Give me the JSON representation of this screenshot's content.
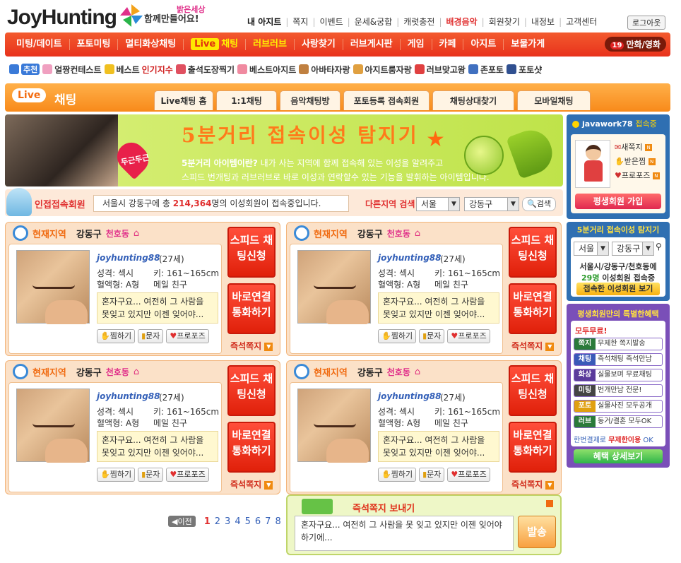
{
  "header": {
    "logo": "JoyHunting",
    "slogan": "함께만들어요!",
    "bright_world": "밝은세상",
    "top_links": [
      "내 아지트",
      "쪽지",
      "이벤트",
      "운세&궁합",
      "캐럿충전",
      "배경음악",
      "회원찾기",
      "내정보",
      "고객센터"
    ],
    "logout": "로그아웃"
  },
  "main_nav": {
    "items": [
      "미팅/데이트",
      "포토미팅",
      "멀티화상채팅",
      "채팅",
      "러브러브",
      "사랑찾기",
      "러브게시판",
      "게임",
      "카페",
      "아지트",
      "보물가게"
    ],
    "live_badge": "Live",
    "adult": "만화/영화",
    "adult_badge": "19"
  },
  "sub_nav": {
    "recommend": "추천",
    "items": [
      "얼짱컨테스트",
      "베스트",
      "인기지수",
      "출석도장찍기",
      "베스트아지트",
      "아바타자랑",
      "아지트룸자랑",
      "러브맞고왕",
      "존포토",
      "포토샷"
    ]
  },
  "live_chat": {
    "badge": "Live",
    "title": "채팅",
    "tabs": [
      "Live채팅 홈",
      "1:1채팅",
      "음악채팅방",
      "포토등록 접속회원",
      "채팅상대찾기",
      "모바일채팅"
    ]
  },
  "banner": {
    "title": "5분거리 접속이성 탐지기",
    "heart": "두근두근",
    "q": "5분거리 아이템이란?",
    "line1": "내가 사는 지역에 함께 접속해 있는 이성을 알려주고",
    "line2": "스피드 번개팅과 러브러브로 바로 이성과 연락할수 있는 기능을 발휘하는 아이템입니다."
  },
  "nearby": {
    "label": "인접접속회원",
    "prefix": "서울시 강동구에 총 ",
    "count": "214,364",
    "suffix": "명의 이성회원이 접속중입니다.",
    "other_label": "다른지역 검색",
    "city": "서울",
    "district": "강동구",
    "search": "검색"
  },
  "card": {
    "current_label": "현재지역",
    "district": "강동구",
    "dong": "천호동",
    "username": "joyhunting88",
    "age": "(27세)",
    "personality": "성격: 섹시",
    "height": "키: 161~165cm",
    "blood": "혈액형: A형",
    "friend": "메일 친구",
    "message": "혼자구요... 여전히 그 사람을 못잊고 있지만 이젠 잊어야...",
    "btn_like": "찜하기",
    "btn_sms": "문자",
    "btn_propose": "프로포즈",
    "speed": "스피드 채팅신청",
    "call": "바로연결 통화하기",
    "instant": "즉석쪽지"
  },
  "pager": {
    "prev": "이전",
    "pages": [
      "1",
      "2",
      "3",
      "4",
      "5",
      "6",
      "7",
      "8"
    ],
    "current": "1"
  },
  "instant_msg": {
    "title": "즉석쪽지 보내기",
    "text": "혼자구요... 여전히 그 사람을 못 잊고 있지만 이젠 잊어야 하기에...",
    "send": "발송"
  },
  "user_box": {
    "username": "javawork78",
    "online": "접속중",
    "new_msg": "새쪽지",
    "received": "받은찜",
    "propose": "프로포즈",
    "join": "평생회원 가입"
  },
  "detector": {
    "title": "5분거리 접속이성 탐지기",
    "city": "서울",
    "district": "강동구",
    "area": "서울시/강동구/천호동에",
    "count": "29명",
    "count_suffix": " 이성회원 접속중",
    "see": "접속한 이성회원 보기"
  },
  "benefits": {
    "title": "평생회원만의 특별한혜택",
    "free": "모두무료!",
    "rows": [
      {
        "k": "쪽지",
        "v": "무제한 쪽지발송"
      },
      {
        "k": "채팅",
        "v": "즉석채팅 즉석만남"
      },
      {
        "k": "화상",
        "v": "실물보며 무료채팅"
      },
      {
        "k": "미팅",
        "v": "번개만남 전문!"
      },
      {
        "k": "포토",
        "v": "실물사진 모두공개"
      },
      {
        "k": "러브",
        "v": "동거/결혼 모두OK"
      }
    ],
    "foot_pre": "한번결제로 ",
    "foot_b": "무제한이용",
    "foot_post": " OK",
    "more": "혜택 상세보기"
  },
  "colors": {
    "accent": "#e8321c",
    "live": "#f88a1a",
    "card_bg": "#fbe1c8",
    "right_blue": "#2f6fb2",
    "right_purple": "#7a4fb8"
  }
}
